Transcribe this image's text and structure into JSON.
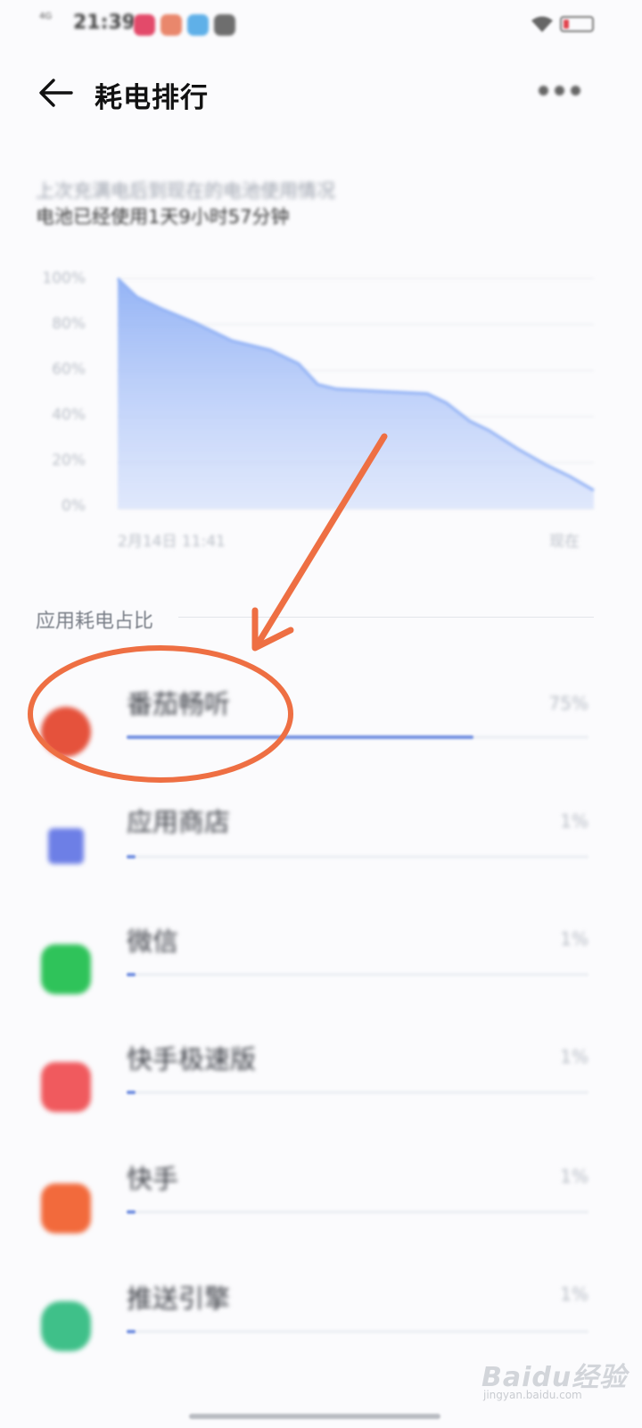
{
  "status_bar": {
    "network": "4G",
    "time": "21:39",
    "notification_colors": [
      "#e34a6a",
      "#e9876c",
      "#5fb0e8",
      "#6e6e6e"
    ]
  },
  "header": {
    "title": "耗电排行",
    "back_icon": "arrow-left-icon",
    "more_icon": "more-dots-icon"
  },
  "summary": {
    "caption": "上次充满电后到现在的电池使用情况",
    "duration": "电池已经使用1天9小时57分钟"
  },
  "chart_data": {
    "type": "area",
    "y_ticks": [
      "100%",
      "80%",
      "60%",
      "40%",
      "20%",
      "0%"
    ],
    "x_tick_start": "2月14日 11:41",
    "x_tick_end": "现在",
    "ylim": [
      0,
      100
    ],
    "series": [
      {
        "x": [
          0,
          0.04,
          0.09,
          0.16,
          0.24,
          0.32,
          0.38,
          0.42,
          0.46,
          0.55,
          0.65,
          0.69,
          0.74,
          0.78,
          0.84,
          0.9,
          0.95,
          1.0
        ],
        "values": [
          100,
          92,
          87,
          81,
          73,
          69,
          63,
          54,
          52,
          51,
          50,
          46,
          38,
          34,
          26,
          19,
          14,
          8
        ]
      }
    ],
    "fill_color": "#8fb0f5"
  },
  "section": {
    "title": "应用耗电占比"
  },
  "apps": [
    {
      "name": "番茄畅听",
      "percent_label": "75%",
      "usage": 0.75,
      "icon": "tomato-app-icon",
      "color": "#e5523c"
    },
    {
      "name": "应用商店",
      "percent_label": "1%",
      "usage": 0.01,
      "icon": "app-store-icon",
      "color": "#6d7fe6"
    },
    {
      "name": "微信",
      "percent_label": "1%",
      "usage": 0.01,
      "icon": "wechat-icon",
      "color": "#2fc35a"
    },
    {
      "name": "快手极速版",
      "percent_label": "1%",
      "usage": 0.01,
      "icon": "kuaishou-lite-icon",
      "color": "#f05a5e"
    },
    {
      "name": "快手",
      "percent_label": "1%",
      "usage": 0.01,
      "icon": "kuaishou-icon",
      "color": "#f26a3c"
    },
    {
      "name": "推送引擎",
      "percent_label": "1%",
      "usage": 0.01,
      "icon": "push-engine-icon",
      "color": "#3fc089"
    }
  ],
  "watermark": {
    "brand": "Baidu经验",
    "url": "jingyan.baidu.com"
  }
}
